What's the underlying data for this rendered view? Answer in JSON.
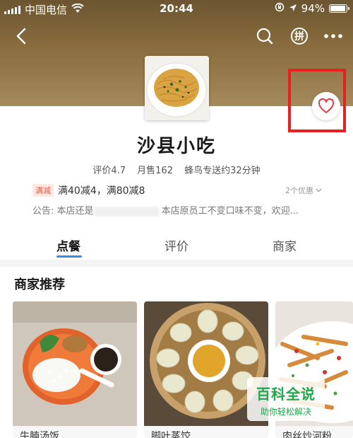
{
  "status_bar": {
    "carrier": "中国电信",
    "time": "20:44",
    "battery_percent": "94%",
    "battery_level": 0.94
  },
  "header": {
    "icons": [
      "back-arrow-icon",
      "search-icon",
      "group-buy-icon",
      "more-icon"
    ],
    "group_buy_glyph": "拼"
  },
  "store": {
    "name": "沙县小吃",
    "rating": "评价4.7",
    "monthly_sales": "月售162",
    "delivery": "蜂鸟专送约32分钟",
    "promo_tag": "满减",
    "promo_text": "满40减4，满80减8",
    "promo_more": "2个优惠",
    "notice_prefix": "公告: 本店还是",
    "notice_suffix": "本店原员工不变口味不变，欢迎..."
  },
  "tabs": [
    {
      "label": "点餐",
      "active": true
    },
    {
      "label": "评价",
      "active": false
    },
    {
      "label": "商家",
      "active": false
    }
  ],
  "recommend": {
    "title": "商家推荐",
    "items": [
      {
        "name": "牛腩汤饭"
      },
      {
        "name": "脚叶蒸饺"
      },
      {
        "name": "肉丝炒河粉"
      }
    ]
  },
  "watermark": {
    "title": "百科全说",
    "subtitle": "助你轻松解决"
  },
  "colors": {
    "accent_blue": "#2f8fe6",
    "promo_red": "#f0553d",
    "highlight_red": "#e8201e",
    "heart": "#e23b3b",
    "watermark_green": "#1ea84b"
  }
}
